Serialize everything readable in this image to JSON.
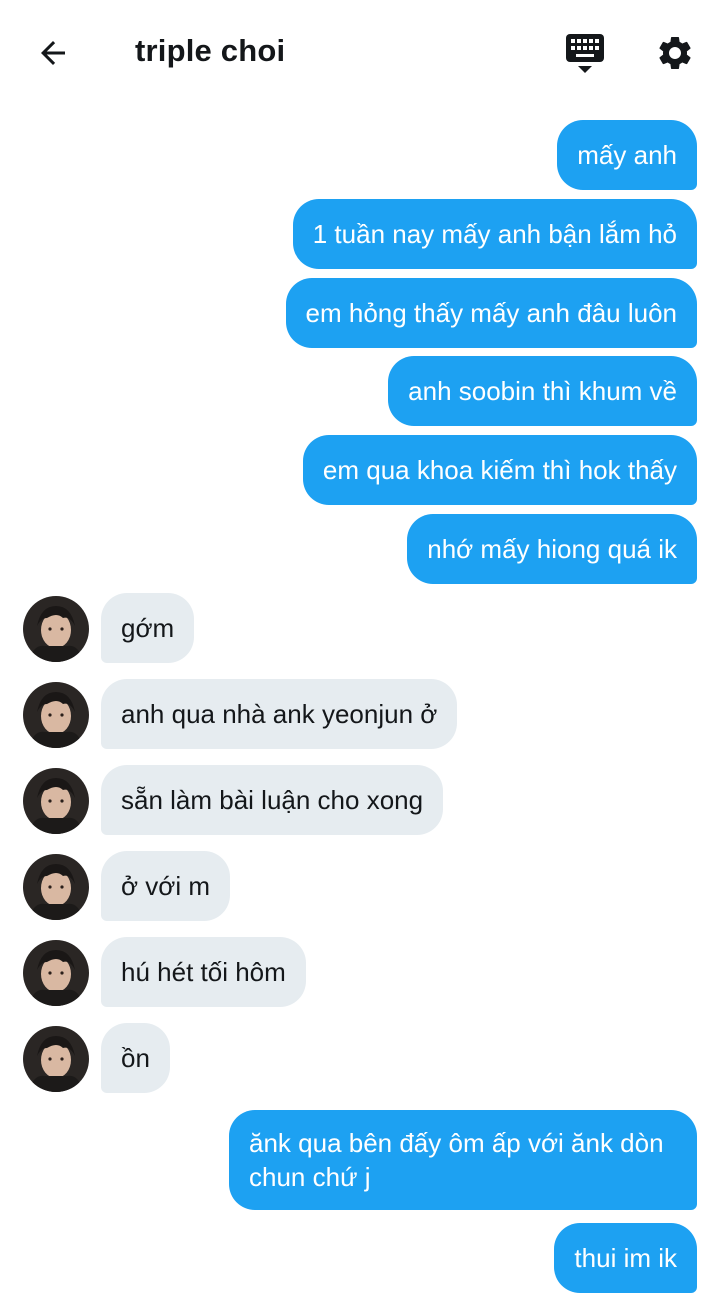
{
  "header": {
    "title": "triple choi",
    "icons": [
      "arrow-left-icon",
      "keyboard-icon",
      "gear-icon"
    ]
  },
  "colors": {
    "outgoing_bubble": "#1da1f2",
    "incoming_bubble": "#e6ecf0",
    "text_dark": "#14171a"
  },
  "messages": [
    {
      "from": "me",
      "text": "mấy anh"
    },
    {
      "from": "me",
      "text": "1 tuần nay mấy anh bận lắm hỏ"
    },
    {
      "from": "me",
      "text": "em hỏng thấy mấy anh đâu luôn"
    },
    {
      "from": "me",
      "text": "anh soobin thì khum về"
    },
    {
      "from": "me",
      "text": "em qua khoa kiếm thì hok thấy"
    },
    {
      "from": "me",
      "text": "nhớ mấy hiong quá ik"
    },
    {
      "from": "them",
      "text": "gớm"
    },
    {
      "from": "them",
      "text": "anh qua nhà ank yeonjun ở"
    },
    {
      "from": "them",
      "text": "sẵn làm bài luận cho xong"
    },
    {
      "from": "them",
      "text": "ở với m"
    },
    {
      "from": "them",
      "text": "hú hét tối hôm"
    },
    {
      "from": "them",
      "text": "ồn"
    },
    {
      "from": "me",
      "text": "ănk qua bên đấy ôm ấp với ănk dòn chun chứ j"
    },
    {
      "from": "me",
      "text": "thui im ik"
    }
  ]
}
